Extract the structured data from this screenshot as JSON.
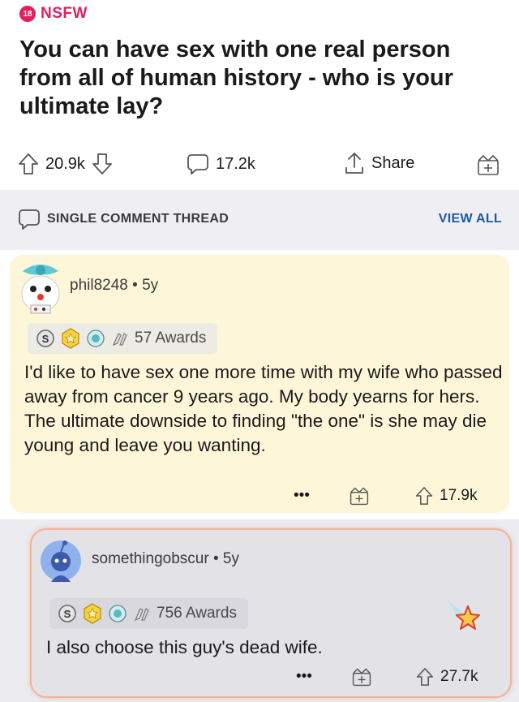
{
  "post": {
    "nsfw_badge": "18",
    "nsfw_label": "NSFW",
    "title": "You can have sex with one real person from all of human history - who is your ultimate lay?",
    "upvotes": "20.9k",
    "comments": "17.2k",
    "share_label": "Share"
  },
  "thread": {
    "label": "SINGLE COMMENT THREAD",
    "view_all": "VIEW ALL"
  },
  "comments": [
    {
      "username": "phil8248",
      "age": "5y",
      "awards": "57 Awards",
      "body": "I'd like to have sex one more time with my wife who passed away from cancer 9 years ago.  My body yearns for hers.  The ultimate downside to finding \"the one\" is she may die young and leave you wanting.",
      "more": "•••",
      "votes": "17.9k"
    },
    {
      "username": "somethingobscur",
      "age": "5y",
      "awards": "756 Awards",
      "body": "I also choose this guy's dead wife.",
      "more": "•••",
      "votes": "27.7k"
    }
  ],
  "colors": {
    "nsfw": "#e0215b",
    "link": "#1c5aa8",
    "highlight": "#fdf6d9",
    "reply_border": "#f2b39a"
  }
}
